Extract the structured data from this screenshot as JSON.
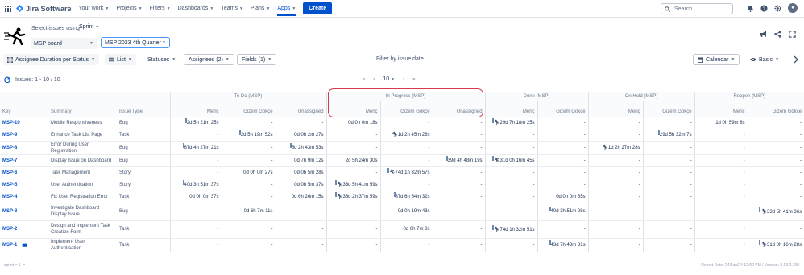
{
  "topnav": {
    "product": "Jira Software",
    "items": [
      {
        "label": "Your work",
        "active": false
      },
      {
        "label": "Projects",
        "active": false
      },
      {
        "label": "Filters",
        "active": false
      },
      {
        "label": "Dashboards",
        "active": false
      },
      {
        "label": "Teams",
        "active": false
      },
      {
        "label": "Plans",
        "active": false
      },
      {
        "label": "Apps",
        "active": true
      }
    ],
    "create_label": "Create",
    "search_placeholder": "Search",
    "accent": "#0052cc"
  },
  "header": {
    "select_label": "Select issues using",
    "select_mode": "Sprint",
    "board": "MSP board",
    "sprint": "MSP 2023 4th Quarter"
  },
  "toolbar": {
    "report": "Assignee Duration per Status",
    "view": "List",
    "statuses": "Statuses",
    "assignees": "Assignees (2)",
    "fields": "Fields (1)",
    "filter_date": "Filter by issue date...",
    "calendar": "Calendar",
    "mode": "Basic"
  },
  "issues_info": {
    "label": "Issues: 1 - 10 / 10",
    "page_size": "10"
  },
  "columns": {
    "key": "Key",
    "summary": "Summary",
    "type": "Issue Type",
    "groups": [
      "To Do (MSP)",
      "In Progress (MSP)",
      "Done (MSP)",
      "On Hold (MSP)",
      "Reopen (MSP)"
    ],
    "sub": [
      [
        "Meriç",
        "Gizem Gökçe",
        "Unassigned"
      ],
      [
        "Meriç",
        "Gizem Gökçe",
        "Unassigned"
      ],
      [
        "Meriç",
        "Gizem Gökçe"
      ],
      [
        "Meriç",
        "Gizem Gökçe"
      ],
      [
        "Meriç",
        "Gizem Gökçe"
      ]
    ]
  },
  "rows": [
    {
      "key": "MSP-10",
      "summary": "Mobile Responsiveness",
      "type": "Bug",
      "chart": false,
      "cells": [
        {
          "t": "2d 5h 21m 25s",
          "b": 0
        },
        {
          "t": "-"
        },
        {
          "t": "-"
        },
        {
          "t": "0d 0h 0m 18s"
        },
        {
          "t": "-"
        },
        {
          "t": "-"
        },
        {
          "t": "29d 7h 18m 25s",
          "b": 0.45,
          "r": true
        },
        {
          "t": "-"
        },
        {
          "t": "-"
        },
        {
          "t": "-"
        },
        {
          "t": "1d 0h 59m 8s"
        },
        {
          "t": "-"
        }
      ]
    },
    {
      "key": "MSP-9",
      "summary": "Enhance Task List Page",
      "type": "Task",
      "chart": false,
      "cells": [
        {
          "t": "-"
        },
        {
          "t": "2d 5h 19m 52s",
          "b": 0
        },
        {
          "t": "0d 0h 2m 27s"
        },
        {
          "t": "-"
        },
        {
          "t": "1d 2h 45m 28s",
          "r": true
        },
        {
          "t": "-"
        },
        {
          "t": "-"
        },
        {
          "t": "-"
        },
        {
          "t": "-"
        },
        {
          "t": "29d 5h 32m 7s",
          "b": 0.35
        },
        {
          "t": "-"
        },
        {
          "t": "-"
        }
      ]
    },
    {
      "key": "MSP-8",
      "summary": "Error During User Registration",
      "type": "Bug",
      "chart": false,
      "cells": [
        {
          "t": "67d 4h 27m 21s",
          "b": 1
        },
        {
          "t": "-"
        },
        {
          "t": "5d 2h 43m 53s",
          "b": 0.05
        },
        {
          "t": "-"
        },
        {
          "t": "-"
        },
        {
          "t": "-"
        },
        {
          "t": "-"
        },
        {
          "t": "-"
        },
        {
          "t": "1d 2h 27m 28s",
          "r": true
        },
        {
          "t": "-"
        },
        {
          "t": "-"
        },
        {
          "t": "-"
        }
      ]
    },
    {
      "key": "MSP-7",
      "summary": "Display Issue on Dashboard",
      "type": "Bug",
      "chart": false,
      "cells": [
        {
          "t": "-"
        },
        {
          "t": "-"
        },
        {
          "t": "0d 7h 9m 12s"
        },
        {
          "t": "2d 5h 24m 30s"
        },
        {
          "t": "-"
        },
        {
          "t": "39d 4h 48m 19s",
          "b": 0.6
        },
        {
          "t": "31d 0h 16m 45s",
          "b": 0.4,
          "r": true
        },
        {
          "t": "-"
        },
        {
          "t": "-"
        },
        {
          "t": "-"
        },
        {
          "t": "-"
        },
        {
          "t": "-"
        }
      ]
    },
    {
      "key": "MSP-6",
      "summary": "Task Management",
      "type": "Story",
      "chart": false,
      "cells": [
        {
          "t": "-"
        },
        {
          "t": "0d 0h 0m 27s"
        },
        {
          "t": "0d 0h 5m 28s"
        },
        {
          "t": "-"
        },
        {
          "t": "74d 1h 32m 57s",
          "b": 0.95,
          "r": true
        },
        {
          "t": "-"
        },
        {
          "t": "-"
        },
        {
          "t": "-"
        },
        {
          "t": "-"
        },
        {
          "t": "-"
        },
        {
          "t": "-"
        },
        {
          "t": "-"
        }
      ]
    },
    {
      "key": "MSP-5",
      "summary": "User Authentication",
      "type": "Story",
      "chart": false,
      "cells": [
        {
          "t": "40d 3h 51m 37s",
          "b": 0.6
        },
        {
          "t": "-"
        },
        {
          "t": "0d 0h 5m 37s"
        },
        {
          "t": "33d 5h 41m 59s",
          "b": 0.5,
          "r": true
        },
        {
          "t": "-"
        },
        {
          "t": "-"
        },
        {
          "t": "-"
        },
        {
          "t": "-"
        },
        {
          "t": "-"
        },
        {
          "t": "-"
        },
        {
          "t": "-"
        },
        {
          "t": "-"
        }
      ]
    },
    {
      "key": "MSP-4",
      "summary": "Fix User Registration Error",
      "type": "Task",
      "chart": false,
      "cells": [
        {
          "t": "0d 0h 0m 37s"
        },
        {
          "t": "-"
        },
        {
          "t": "0d 6h 26m 15s"
        },
        {
          "t": "36d 2h 37m 59s",
          "b": 0.55,
          "r": true
        },
        {
          "t": "37d 6h 54m 32s",
          "b": 0.55
        },
        {
          "t": "-"
        },
        {
          "t": "-"
        },
        {
          "t": "0d 0h 0m 35s"
        },
        {
          "t": "-"
        },
        {
          "t": "-"
        },
        {
          "t": "-"
        },
        {
          "t": "-"
        }
      ]
    },
    {
      "key": "MSP-3",
      "summary": "Investigate Dashboard Display Issue",
      "type": "Bug",
      "chart": false,
      "cells": [
        {
          "t": "-"
        },
        {
          "t": "0d 6h 7m 11s"
        },
        {
          "t": "-"
        },
        {
          "t": "-"
        },
        {
          "t": "0d 0h 19m 43s"
        },
        {
          "t": "-"
        },
        {
          "t": "-"
        },
        {
          "t": "40d 3h 51m 28s",
          "b": 0.6
        },
        {
          "t": "-"
        },
        {
          "t": "-"
        },
        {
          "t": "-"
        },
        {
          "t": "33d 5h 41m 36s",
          "b": 0.5,
          "r": true
        }
      ]
    },
    {
      "key": "MSP-2",
      "summary": "Design and Implement Task Creation Form",
      "type": "Task",
      "chart": false,
      "cells": [
        {
          "t": "-"
        },
        {
          "t": "-"
        },
        {
          "t": "-"
        },
        {
          "t": "-"
        },
        {
          "t": "0d 6h 7m 8s"
        },
        {
          "t": "-"
        },
        {
          "t": "74d 1h 32m 51s",
          "b": 0.95,
          "r": true
        },
        {
          "t": "-"
        },
        {
          "t": "-"
        },
        {
          "t": "-"
        },
        {
          "t": "-"
        },
        {
          "t": "-"
        }
      ]
    },
    {
      "key": "MSP-1",
      "summary": "Implement User Authentication",
      "type": "Task",
      "chart": true,
      "cells": [
        {
          "t": "-"
        },
        {
          "t": "-"
        },
        {
          "t": "-"
        },
        {
          "t": "-"
        },
        {
          "t": "-"
        },
        {
          "t": "-"
        },
        {
          "t": "-"
        },
        {
          "t": "43d 7h 43m 31s",
          "b": 0.65
        },
        {
          "t": "-"
        },
        {
          "t": "-"
        },
        {
          "t": "-"
        },
        {
          "t": "31d 0h 16m 28s",
          "b": 0.45,
          "r": true
        }
      ]
    }
  ],
  "footer": {
    "left": "sprint = 1",
    "right": "Report Date: 24/Jan/24 12:02 PM / Version: 2.19.2.798"
  },
  "bar_color": "#b3cbe3"
}
